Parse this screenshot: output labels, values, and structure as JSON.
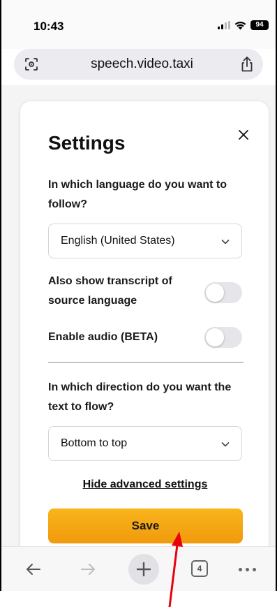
{
  "status_bar": {
    "time": "10:43",
    "battery": "94"
  },
  "browser": {
    "url": "speech.video.taxi",
    "tab_count": "4"
  },
  "settings": {
    "title": "Settings",
    "language_question": "In which language do you want to follow?",
    "language_selected": "English (United States)",
    "transcript_label": "Also show transcript of source language",
    "transcript_enabled": false,
    "audio_label": "Enable audio (BETA)",
    "audio_enabled": false,
    "direction_question": "In which direction do you want the text to flow?",
    "direction_selected": "Bottom to top",
    "advanced_link": "Hide advanced settings",
    "save_label": "Save"
  },
  "colors": {
    "accent_top": "#f8b51c",
    "accent_bottom": "#f19a0c",
    "annotation_arrow": "#e8000b"
  }
}
